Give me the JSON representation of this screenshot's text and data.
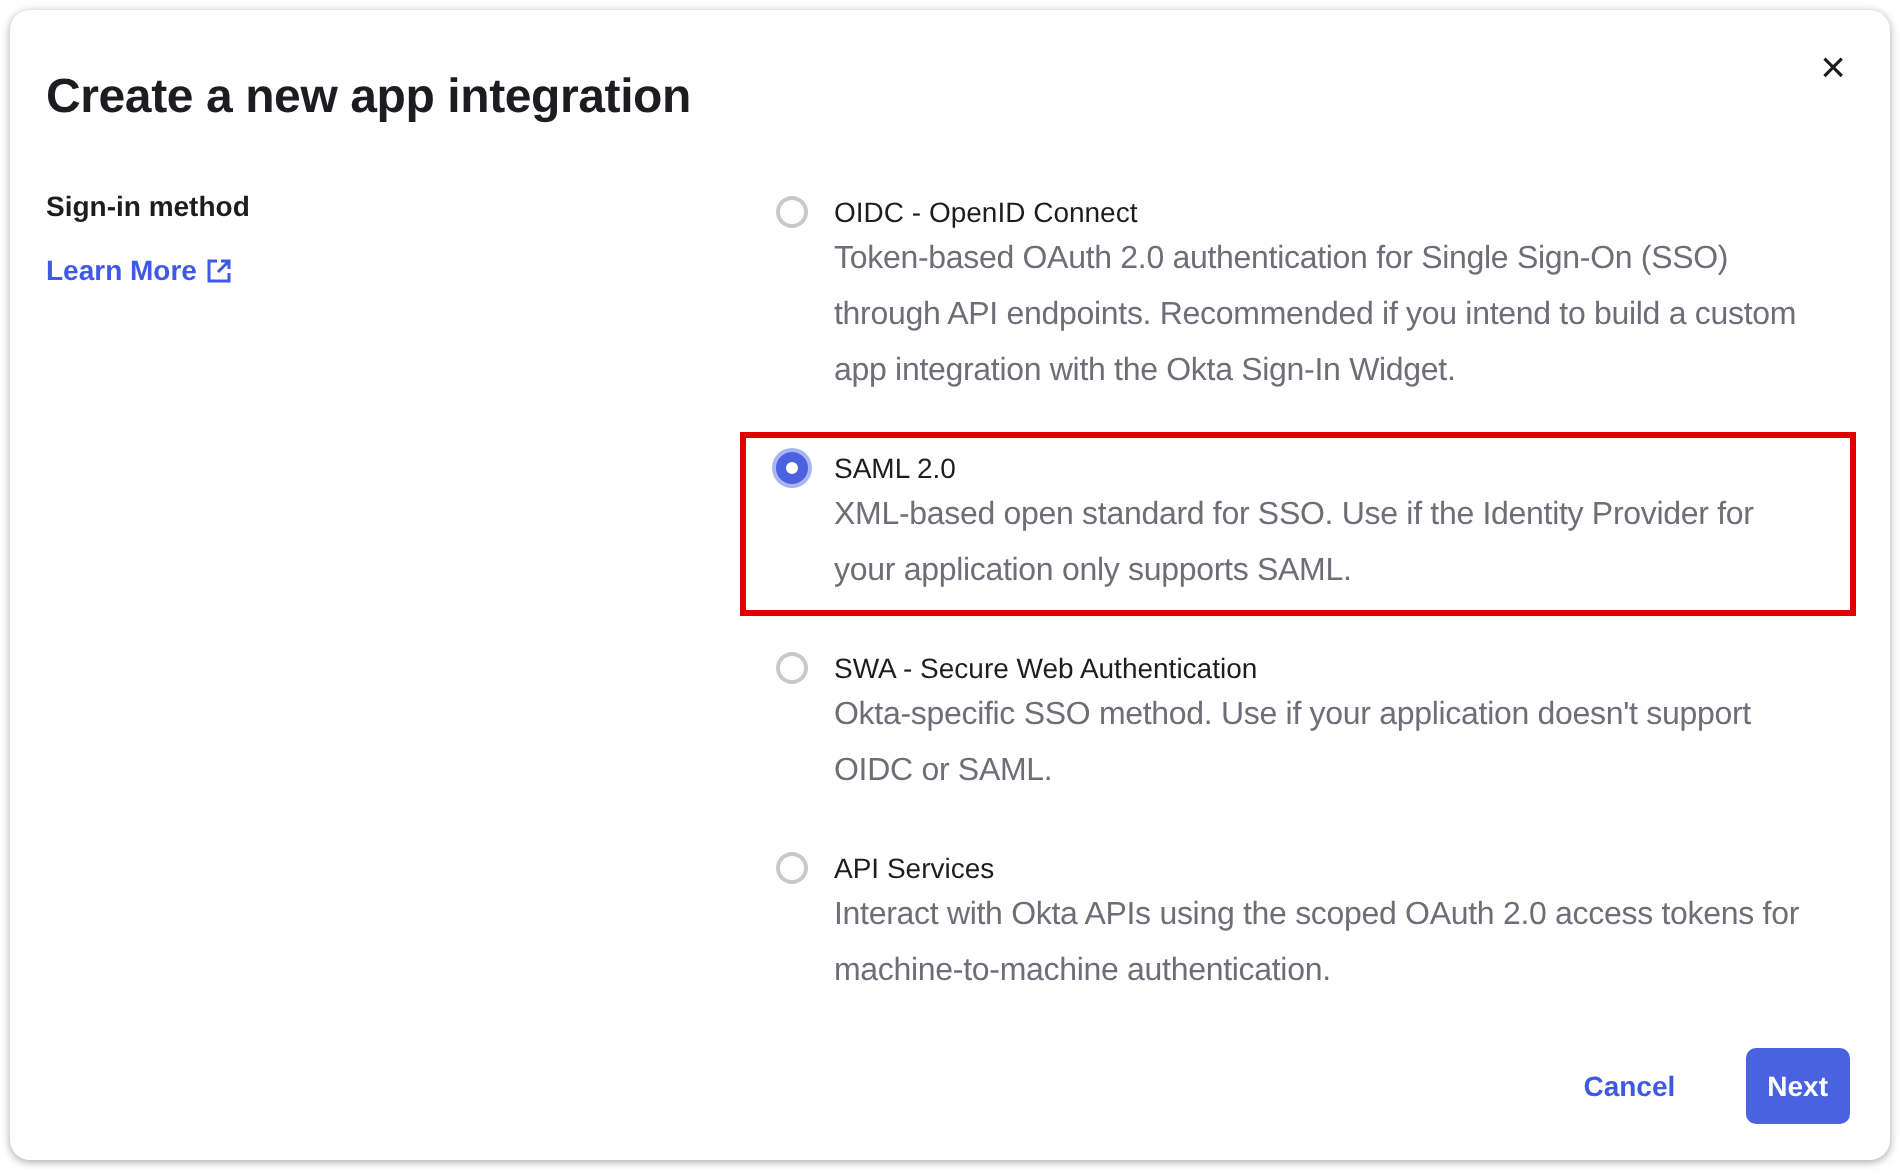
{
  "dialog": {
    "title": "Create a new app integration",
    "close": "×"
  },
  "section": {
    "label": "Sign-in method",
    "link": "Learn More"
  },
  "options": [
    {
      "title": "OIDC - OpenID Connect",
      "description": "Token-based OAuth 2.0 authentication for Single Sign-On (SSO) through API endpoints. Recommended if you intend to build a custom app integration with the Okta Sign-In Widget.",
      "selected": false,
      "highlighted": false
    },
    {
      "title": "SAML 2.0",
      "description": "XML-based open standard for SSO. Use if the Identity Provider for your application only supports SAML.",
      "selected": true,
      "highlighted": true
    },
    {
      "title": "SWA - Secure Web Authentication",
      "description": "Okta-specific SSO method. Use if your application doesn't support OIDC or SAML.",
      "selected": false,
      "highlighted": false
    },
    {
      "title": "API Services",
      "description": "Interact with Okta APIs using the scoped OAuth 2.0 access tokens for machine-to-machine authentication.",
      "selected": false,
      "highlighted": false
    }
  ],
  "buttons": [
    {
      "label": "Cancel",
      "kind": "secondary"
    },
    {
      "label": "Next",
      "kind": "primary"
    }
  ]
}
